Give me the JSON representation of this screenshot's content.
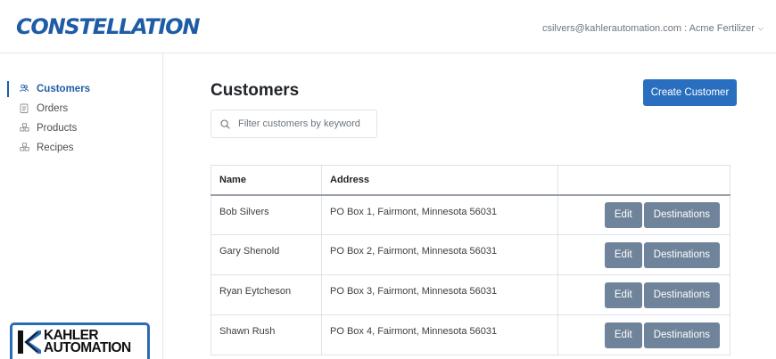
{
  "header": {
    "brand": "CONSTELLATION",
    "user_menu": "csilvers@kahlerautomation.com : Acme Fertilizer"
  },
  "sidebar": {
    "items": [
      {
        "label": "Customers",
        "icon": "users-icon",
        "active": true
      },
      {
        "label": "Orders",
        "icon": "clipboard-icon",
        "active": false
      },
      {
        "label": "Products",
        "icon": "boxes-icon",
        "active": false
      },
      {
        "label": "Recipes",
        "icon": "boxes-icon",
        "active": false
      }
    ],
    "logo": {
      "line1": "KAHLER",
      "line2": "AUTOMATION"
    }
  },
  "main": {
    "title": "Customers",
    "create_button": "Create Customer",
    "search_placeholder": "Filter customers by keyword",
    "table": {
      "headers": [
        "Name",
        "Address",
        ""
      ],
      "rows": [
        {
          "name": "Bob Silvers",
          "address": "PO Box 1, Fairmont, Minnesota 56031"
        },
        {
          "name": "Gary Shenold",
          "address": "PO Box 2, Fairmont, Minnesota 56031"
        },
        {
          "name": "Ryan Eytcheson",
          "address": "PO Box 3, Fairmont, Minnesota 56031"
        },
        {
          "name": "Shawn Rush",
          "address": "PO Box 4, Fairmont, Minnesota 56031"
        }
      ],
      "edit_label": "Edit",
      "destinations_label": "Destinations"
    }
  },
  "colors": {
    "brand": "#1f5ca6",
    "primary_button": "#2a6ebf",
    "secondary_button": "#6f849a"
  }
}
